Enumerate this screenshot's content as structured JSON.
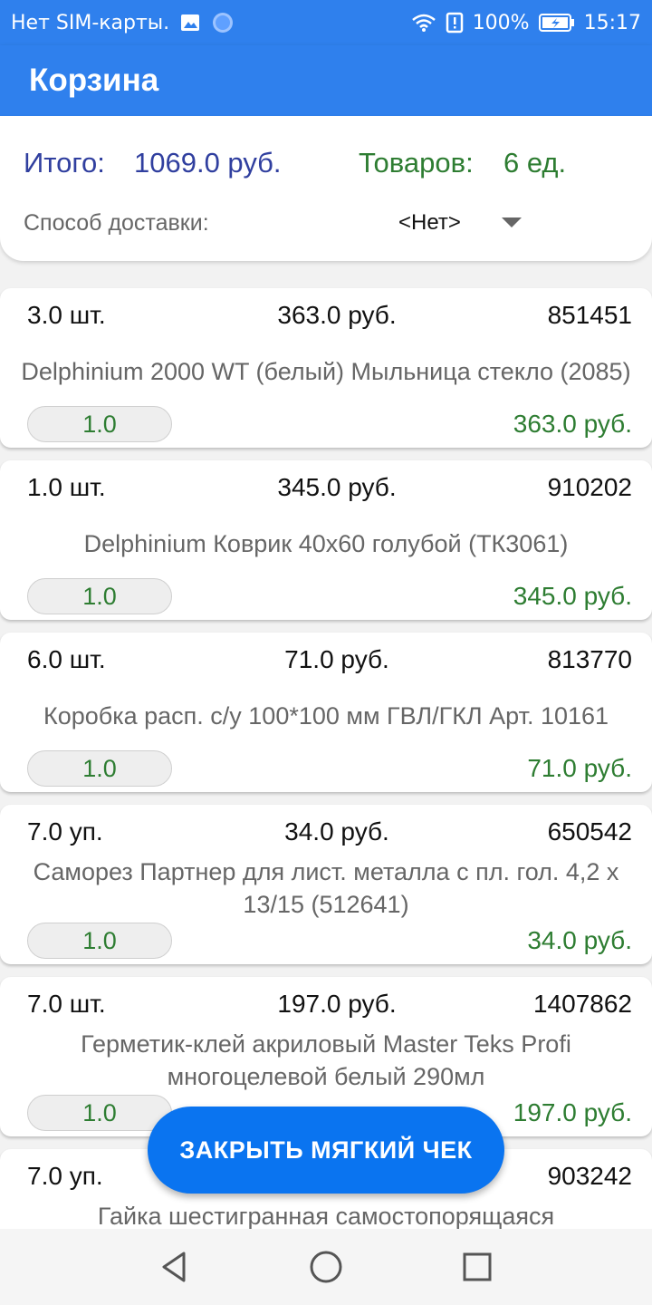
{
  "status_bar": {
    "carrier": "Нет SIM-карты.",
    "battery": "100%",
    "time": "15:17"
  },
  "app_bar": {
    "title": "Корзина"
  },
  "summary": {
    "total_label": "Итого:",
    "total_value": "1069.0 руб.",
    "goods_label": "Товаров:",
    "goods_value": "6 ед.",
    "delivery_label": "Способ доставки:",
    "delivery_value": "<Нет>"
  },
  "items": [
    {
      "qty": "3.0 шт.",
      "price": "363.0 руб.",
      "code": "851451",
      "name": "Delphinium 2000 WT (белый) Мыльница стекло (2085)",
      "counter": "1.0",
      "sum": "363.0 руб."
    },
    {
      "qty": "1.0 шт.",
      "price": "345.0 руб.",
      "code": "910202",
      "name": "Delphinium Коврик 40х60 голубой (ТК3061)",
      "counter": "1.0",
      "sum": "345.0 руб."
    },
    {
      "qty": "6.0 шт.",
      "price": "71.0 руб.",
      "code": "813770",
      "name": "Коробка расп. с/у 100*100 мм ГВЛ/ГКЛ Арт. 10161",
      "counter": "1.0",
      "sum": "71.0 руб."
    },
    {
      "qty": "7.0 уп.",
      "price": "34.0 руб.",
      "code": "650542",
      "name": "Саморез Партнер для лист. металла с пл. гол. 4,2 х 13/15 (512641)",
      "counter": "1.0",
      "sum": "34.0 руб."
    },
    {
      "qty": "7.0 шт.",
      "price": "197.0 руб.",
      "code": "1407862",
      "name": "Герметик-клей акриловый Master Teks Profi многоцелевой белый 290мл",
      "counter": "1.0",
      "sum": "197.0 руб."
    },
    {
      "qty": "7.0 уп.",
      "code": "903242",
      "name": "Гайка шестигранная самостопорящаяся"
    }
  ],
  "fab": {
    "label": "ЗАКРЫТЬ МЯГКИЙ ЧЕК"
  },
  "icons": {
    "image": "image-icon",
    "sync": "sync-circle-icon",
    "wifi": "wifi-icon",
    "alert": "alert-icon",
    "battery": "battery-charging-icon",
    "back": "back-triangle-icon",
    "home": "home-circle-icon",
    "recents": "recents-square-icon"
  },
  "colors": {
    "primary": "#2f80ed",
    "total": "#303f9f",
    "goods": "#2e7d32",
    "fab": "#0a74f0"
  }
}
